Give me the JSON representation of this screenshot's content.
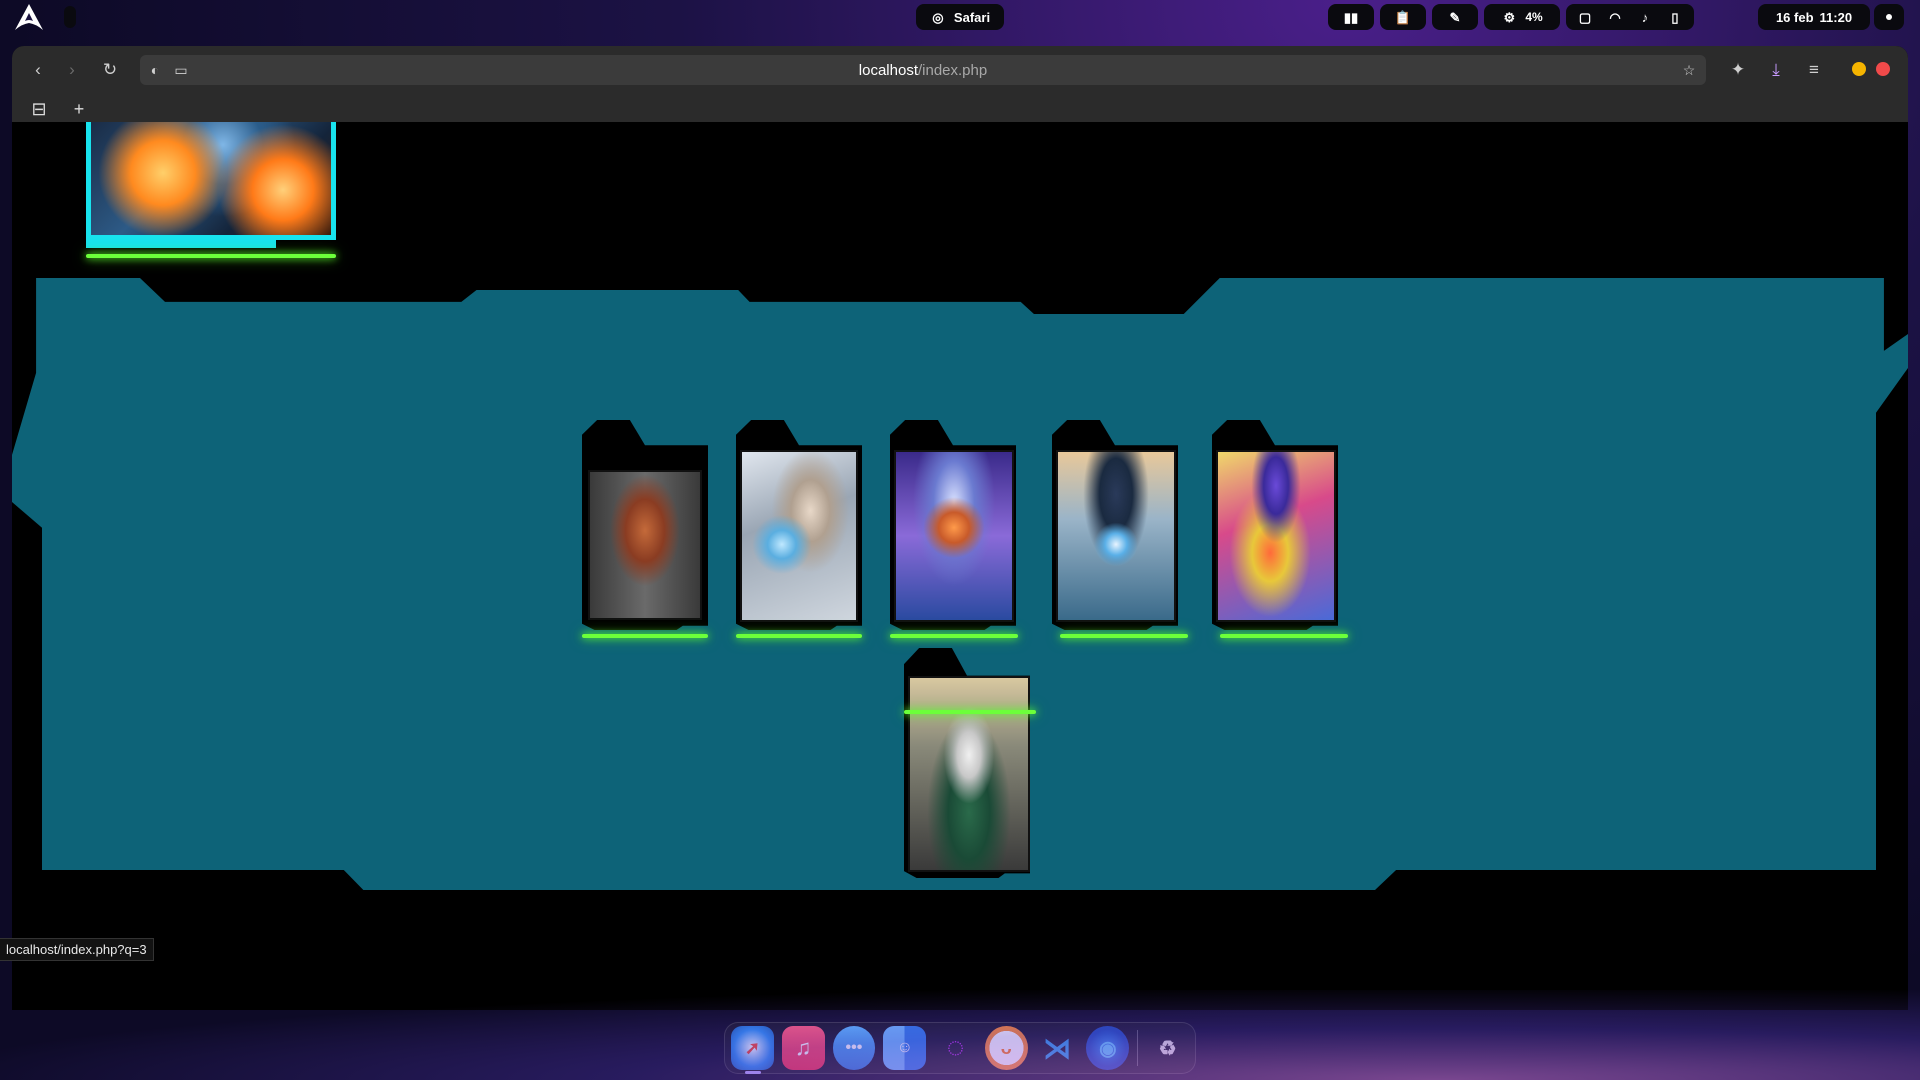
{
  "topbar": {
    "app_name": "Safari",
    "battery_percent": "4%",
    "date": "16 feb",
    "time": "11:20"
  },
  "browser": {
    "url_host": "localhost",
    "url_path": "/index.php",
    "status_url": "localhost/index.php?q=3"
  },
  "colors": {
    "accent_cyan": "#18e3ee",
    "glow_green": "#6cff3a",
    "panel_teal": "#0d6378"
  },
  "cards": [
    {
      "name": "card-1",
      "art": "muscular figure with fruit armor and cape"
    },
    {
      "name": "card-2",
      "art": "hooded figure with glasses and glowing hand"
    },
    {
      "name": "card-3",
      "art": "cosmic armored hero with lightning"
    },
    {
      "name": "card-4",
      "art": "hero with clock emblem"
    },
    {
      "name": "card-5",
      "art": "colorful jester in top hat"
    },
    {
      "name": "card-6",
      "art": "green-haired woman exiting car"
    }
  ],
  "dock": {
    "apps": [
      "safari-icon",
      "music-icon",
      "messages-icon",
      "finder-icon",
      "browser-icon",
      "orange-app-icon",
      "vscode-icon",
      "firefox-icon",
      "trash-icon"
    ]
  }
}
